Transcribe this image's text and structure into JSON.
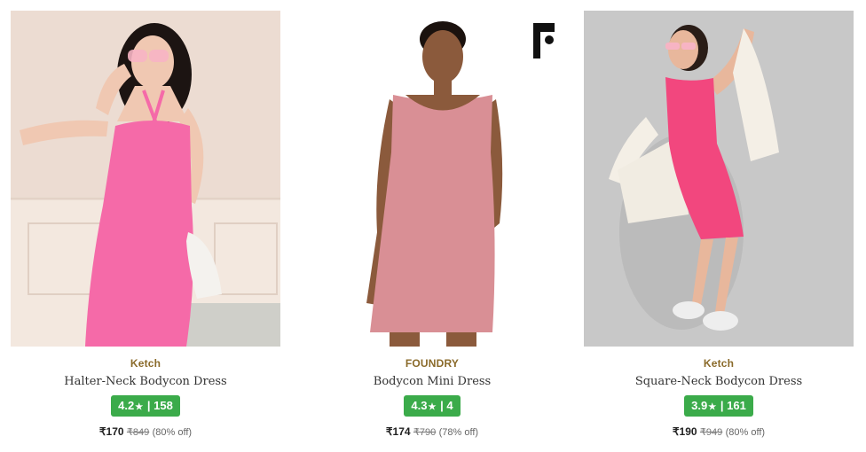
{
  "products": [
    {
      "brand": "Ketch",
      "name": "Halter-Neck Bodycon Dress",
      "rating": "4.2",
      "rating_count": "158",
      "price": "₹170",
      "mrp": "₹849",
      "discount": "(80% off)",
      "image_alt": "Woman in pink halter-neck bodycon dress",
      "image_icon": "product-photo"
    },
    {
      "brand": "FOUNDRY",
      "name": "Bodycon Mini Dress",
      "rating": "4.3",
      "rating_count": "4",
      "price": "₹174",
      "mrp": "₹790",
      "discount": "(78% off)",
      "image_alt": "Woman in dusty pink bodycon mini dress",
      "image_icon": "product-photo"
    },
    {
      "brand": "Ketch",
      "name": "Square-Neck Bodycon Dress",
      "rating": "3.9",
      "rating_count": "161",
      "price": "₹190",
      "mrp": "₹949",
      "discount": "(80% off)",
      "image_alt": "Woman in hot pink square-neck bodycon dress",
      "image_icon": "product-photo"
    }
  ],
  "colors": {
    "brand_text": "#8a6a2a",
    "rating_bg": "#3bab4a",
    "dress_1": "#f56aa8",
    "dress_2": "#d98f95",
    "dress_3": "#f2477e"
  },
  "rating_star": "★",
  "rating_sep": "|"
}
